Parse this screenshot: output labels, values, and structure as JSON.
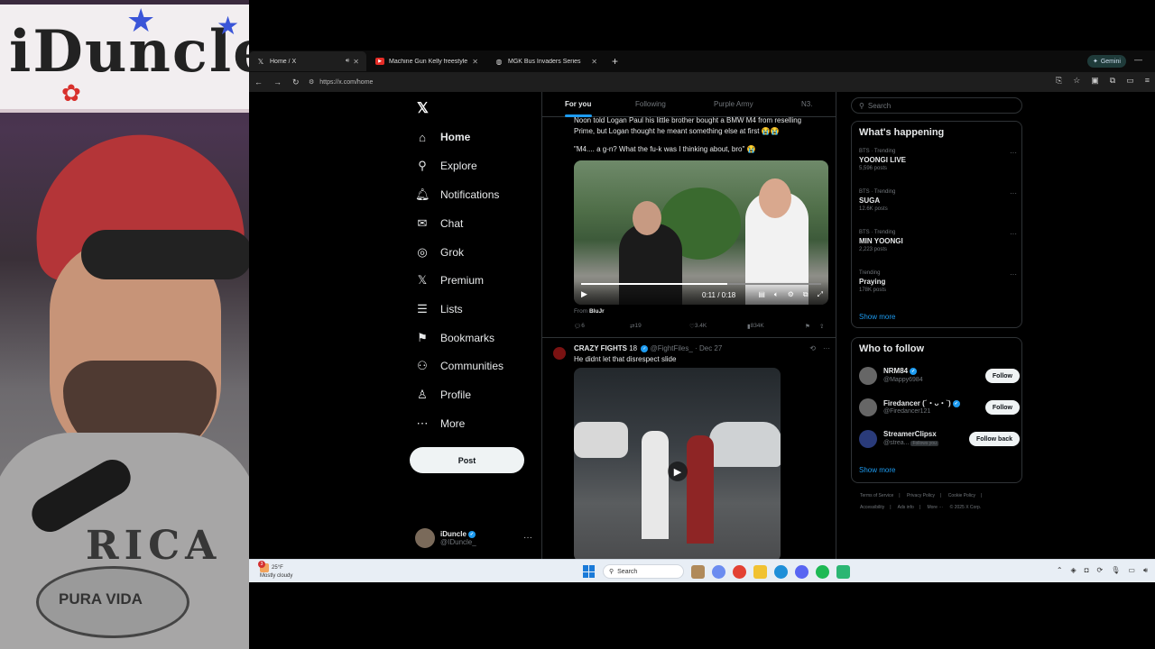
{
  "webcam": {
    "banner_text": "iDuncle",
    "hoodie_text": "RICA",
    "patch_text": "PURA VIDA"
  },
  "browser": {
    "tabs": [
      {
        "title": "Home / X",
        "icon": "x-logo-icon",
        "active": true
      },
      {
        "title": "Machine Gun Kelly freestyle @",
        "icon": "youtube-icon",
        "active": false
      },
      {
        "title": "MGK Bus Invaders Series",
        "icon": "globe-icon",
        "active": false
      }
    ],
    "new_tab": "+",
    "gemini_label": "Gemini",
    "url": "https://x.com/home"
  },
  "nav": {
    "logo": "𝕏",
    "items": [
      {
        "label": "Home",
        "icon": "⌂"
      },
      {
        "label": "Explore",
        "icon": "⚲"
      },
      {
        "label": "Notifications",
        "icon": "🔔︎"
      },
      {
        "label": "Chat",
        "icon": "✉"
      },
      {
        "label": "Grok",
        "icon": "◎"
      },
      {
        "label": "Premium",
        "icon": "𝕏"
      },
      {
        "label": "Lists",
        "icon": "☰"
      },
      {
        "label": "Bookmarks",
        "icon": "⚑"
      },
      {
        "label": "Communities",
        "icon": "⚇"
      },
      {
        "label": "Profile",
        "icon": "♙"
      },
      {
        "label": "More",
        "icon": "⋯"
      }
    ],
    "post_label": "Post",
    "account": {
      "name": "iDuncle",
      "handle": "@IDuncle_"
    }
  },
  "timeline": {
    "tabs": [
      "For you",
      "Following",
      "Purple Army",
      "N3."
    ],
    "tweet1": {
      "text_line1": "Noon told Logan Paul his little brother bought a BMW M4 from reselling",
      "text_line2": "Prime, but Logan thought he meant something else at first 😭😭",
      "text_line3": "\"M4.... a g-n? What the fu-k was I thinking about, bro\" 😭",
      "video_time": "0:11 / 0:18",
      "video_progress": 0.61,
      "from_label": "From",
      "from_name": "BluJr",
      "replies": "6",
      "reposts": "19",
      "likes": "3.4K",
      "views": "834K"
    },
    "tweet2": {
      "name": "CRAZY FIGHTS",
      "badge": "18",
      "handle": "@FightFiles_",
      "date": "Dec 27",
      "text": "He didnt let that disrespect slide"
    }
  },
  "sidebar": {
    "search_placeholder": "Search",
    "happening_title": "What's happening",
    "trends": [
      {
        "context": "BTS · Trending",
        "title": "YOONGI LIVE",
        "count": "5,596 posts"
      },
      {
        "context": "BTS · Trending",
        "title": "SUGA",
        "count": "12.6K posts"
      },
      {
        "context": "BTS · Trending",
        "title": "MIN YOONGI",
        "count": "2,223 posts"
      },
      {
        "context": "Trending",
        "title": "Praying",
        "count": "178K posts"
      }
    ],
    "show_more": "Show more",
    "wtf_title": "Who to follow",
    "follow_suggestions": [
      {
        "name": "NRM84",
        "handle": "@Mappy6984",
        "button": "Follow"
      },
      {
        "name": "Firedancer (´・ᴗ・`)",
        "handle": "@Firedancer121",
        "button": "Follow"
      },
      {
        "name": "StreamerClipsx",
        "handle": "@strea...",
        "button": "Follow back",
        "follows_you": "Follows you"
      }
    ],
    "show_more_2": "Show more",
    "footer_links": [
      "Terms of Service",
      "|",
      "Privacy Policy",
      "|",
      "Cookie Policy",
      "|",
      "Accessibility",
      "|",
      "Ads info",
      "|",
      "More ···",
      "© 2025 X Corp."
    ]
  },
  "taskbar": {
    "temp": "25°F",
    "weather": "Mostly cloudy",
    "badge": "3",
    "search": "Search"
  }
}
